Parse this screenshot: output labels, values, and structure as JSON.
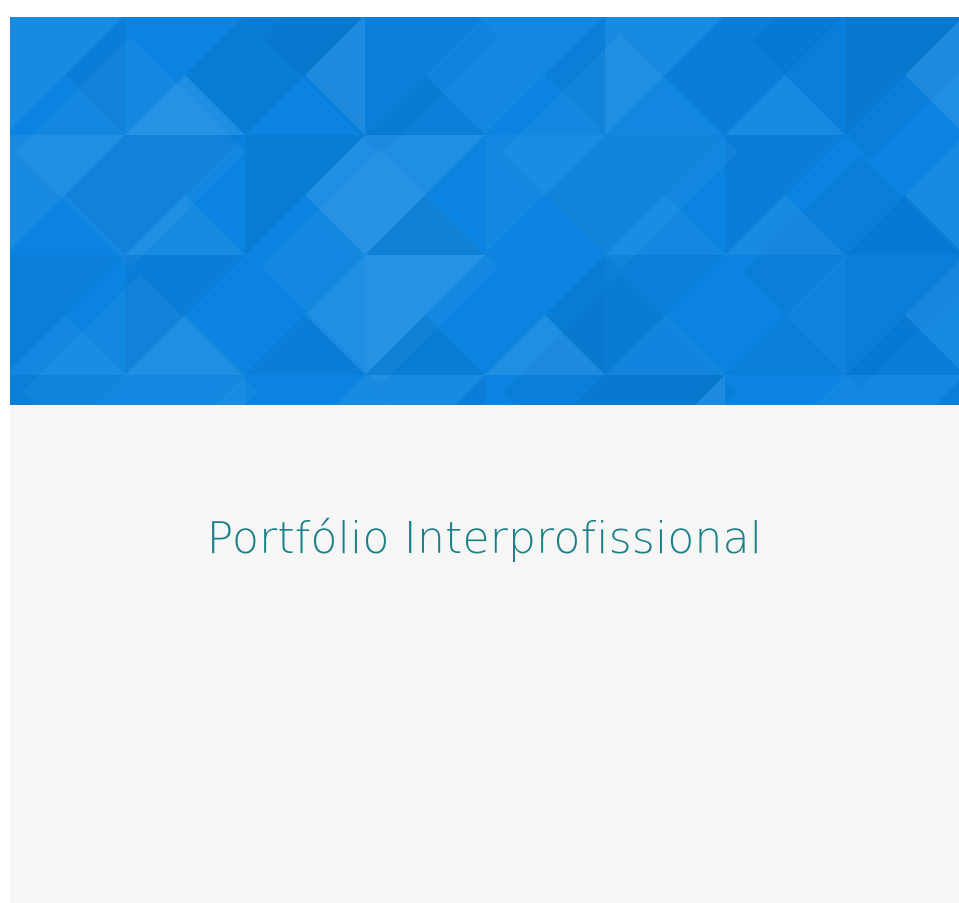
{
  "card": {
    "title": "Portfólio Interprofissional",
    "banner_pattern": "geometric-triangles",
    "colors": {
      "banner_base": "#0a84e0",
      "body_background": "#f6f6f6",
      "title_text": "#1a7f86"
    }
  }
}
